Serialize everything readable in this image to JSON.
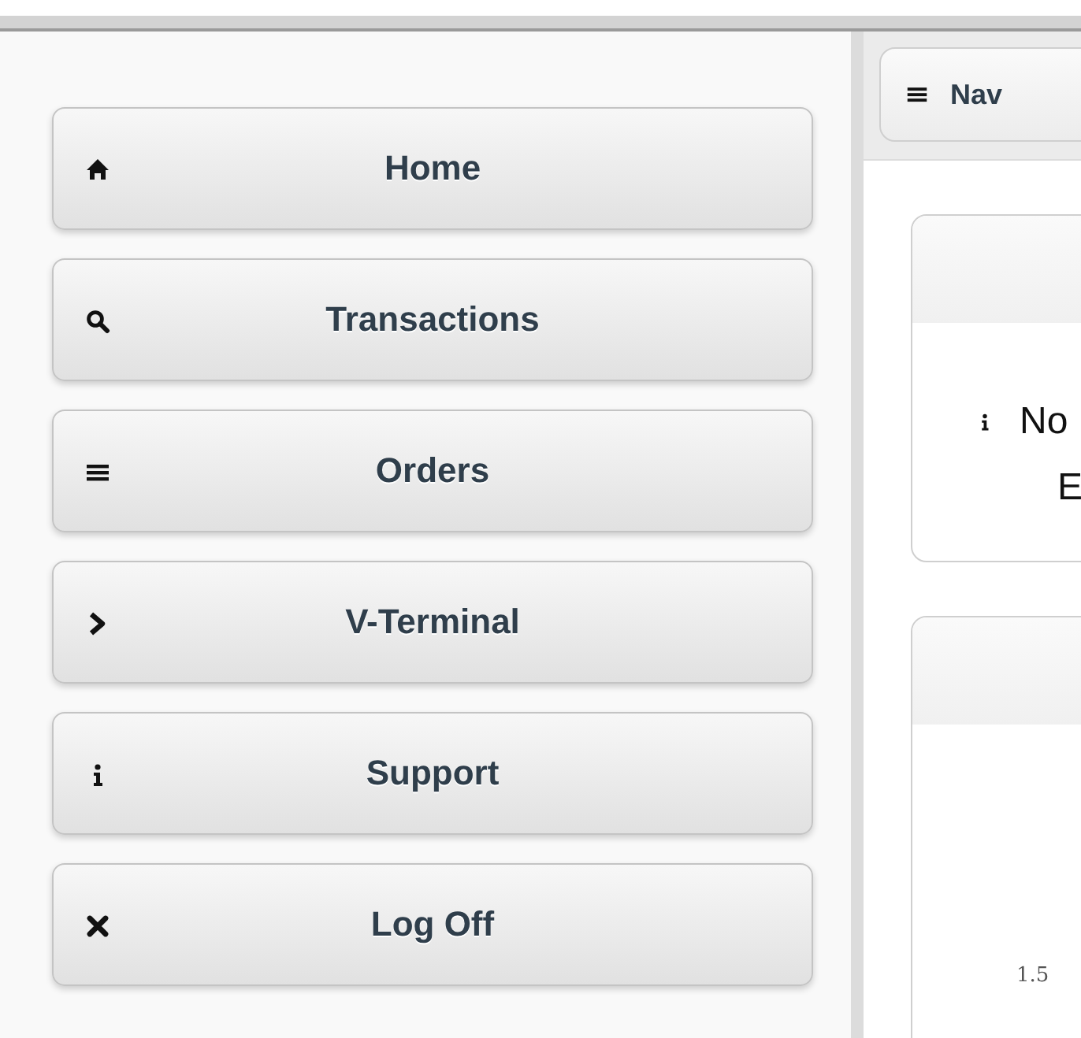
{
  "menu": [
    {
      "kind": "home",
      "label": "Home"
    },
    {
      "kind": "search",
      "label": "Transactions"
    },
    {
      "kind": "bars",
      "label": "Orders"
    },
    {
      "kind": "chevron",
      "label": "V-Terminal"
    },
    {
      "kind": "info",
      "label": "Support"
    },
    {
      "kind": "times",
      "label": "Log Off"
    }
  ],
  "toolbar": {
    "button": {
      "kind": "bars",
      "label": "Nav"
    }
  },
  "cards": [
    {
      "kind": "notice",
      "lines": [
        "No",
        "E"
      ]
    },
    {
      "kind": "chart",
      "tick_label": "1.5"
    }
  ]
}
